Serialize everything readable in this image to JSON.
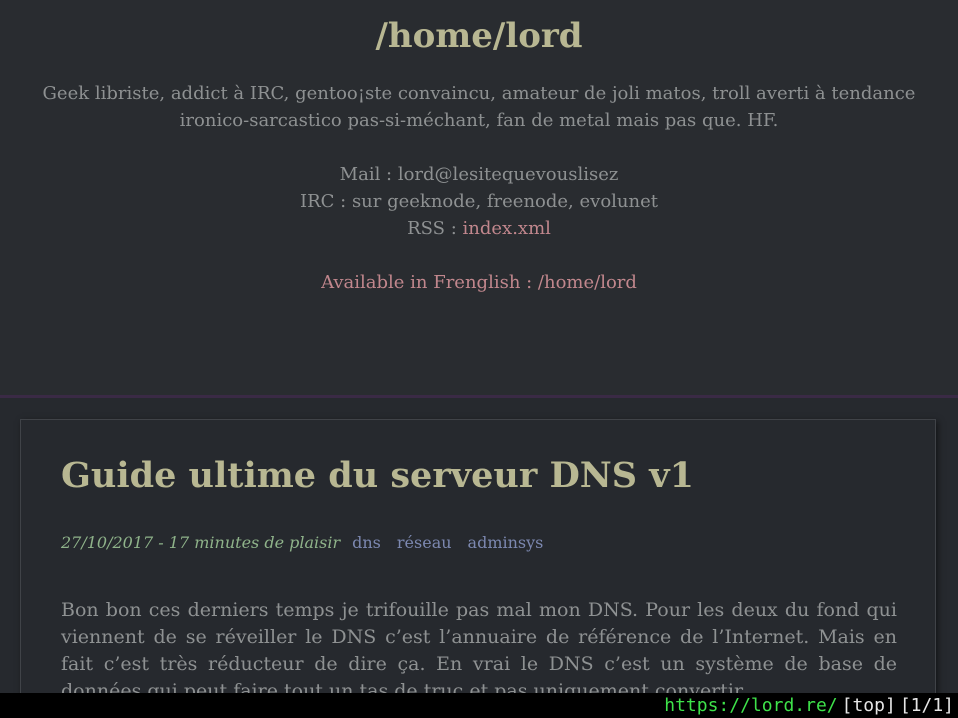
{
  "header": {
    "title": "/home/lord",
    "tagline": "Geek libriste, addict à IRC, gentoo¡ste convaincu, amateur de joli matos, troll averti à tendance ironico-sarcastico pas-si-méchant, fan de metal mais pas que. HF.",
    "mail": "Mail : lord@lesitequevouslisez",
    "irc": "IRC : sur geeknode, freenode, evolunet",
    "rss_label": "RSS : ",
    "rss_link": "index.xml",
    "lang_text": "Available in Frenglish : /home/lord"
  },
  "article": {
    "title": "Guide ultime du serveur DNS v1",
    "meta": "27/10/2017 - 17 minutes de plaisir",
    "tags": [
      "dns",
      "réseau",
      "adminsys"
    ],
    "body": "Bon bon ces derniers temps je trifouille pas mal mon DNS. Pour les deux du fond qui viennent de se réveiller le DNS c’est l’annuaire de référence de l’Internet. Mais en fait c’est très réducteur de dire ça. En vrai le DNS c’est un système de base de données qui peut faire tout un tas de truc et pas uniquement convertir"
  },
  "statusbar": {
    "url": "https://lord.re/",
    "anchor": "[top]",
    "position": "[1/1]"
  },
  "colors": {
    "background": "#26292e",
    "title": "#b8b792",
    "link": "#c1878d",
    "date": "#8fb38a",
    "tag": "#7c88b0",
    "status_url": "#3ee24a"
  }
}
